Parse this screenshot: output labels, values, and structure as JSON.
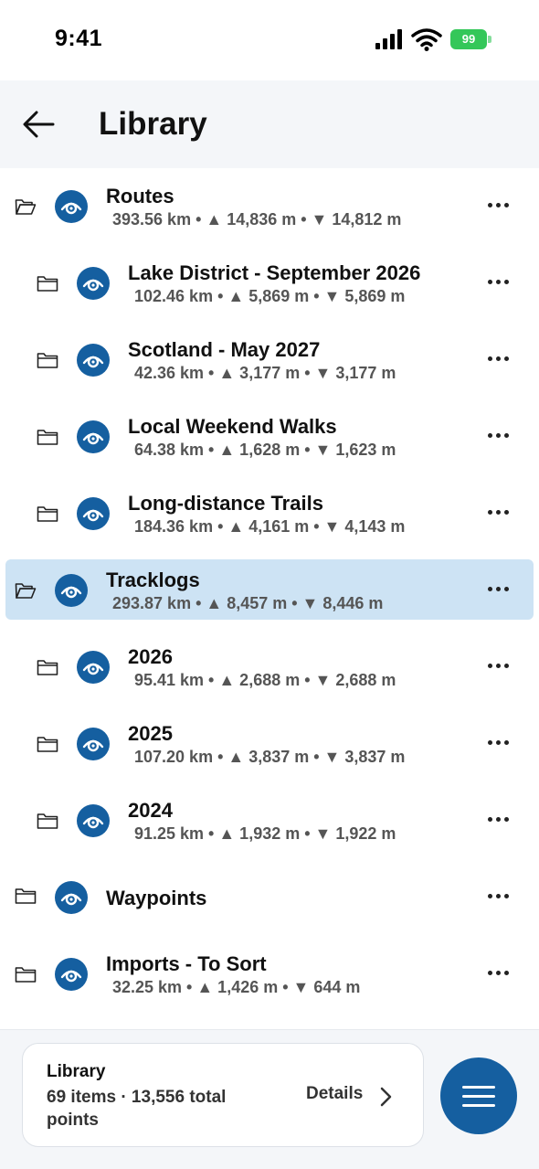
{
  "status_bar": {
    "time": "9:41",
    "battery": "99",
    "battery_color": "#34c759"
  },
  "header": {
    "title": "Library",
    "back_icon": "arrow-left-icon"
  },
  "accent_color": "#155fa0",
  "selected_color": "#cde3f4",
  "items": [
    {
      "title": "Routes",
      "stats": "393.56 km • ▲ 14,836 m • ▼ 14,812 m",
      "level": 0,
      "folder_open": true,
      "selected": false
    },
    {
      "title": "Lake District - September 2026",
      "stats": "102.46 km • ▲ 5,869 m • ▼ 5,869 m",
      "level": 1,
      "folder_open": false,
      "selected": false
    },
    {
      "title": "Scotland - May 2027",
      "stats": "42.36 km • ▲ 3,177 m • ▼ 3,177 m",
      "level": 1,
      "folder_open": false,
      "selected": false
    },
    {
      "title": "Local Weekend Walks",
      "stats": "64.38 km • ▲ 1,628 m • ▼ 1,623 m",
      "level": 1,
      "folder_open": false,
      "selected": false
    },
    {
      "title": "Long-distance Trails",
      "stats": "184.36 km • ▲ 4,161 m • ▼ 4,143 m",
      "level": 1,
      "folder_open": false,
      "selected": false
    },
    {
      "title": "Tracklogs",
      "stats": "293.87 km • ▲ 8,457 m • ▼ 8,446 m",
      "level": 0,
      "folder_open": true,
      "selected": true
    },
    {
      "title": "2026",
      "stats": "95.41 km • ▲ 2,688 m • ▼ 2,688 m",
      "level": 1,
      "folder_open": false,
      "selected": false
    },
    {
      "title": "2025",
      "stats": "107.20 km • ▲ 3,837 m • ▼ 3,837 m",
      "level": 1,
      "folder_open": false,
      "selected": false
    },
    {
      "title": "2024",
      "stats": "91.25 km • ▲ 1,932 m • ▼ 1,922 m",
      "level": 1,
      "folder_open": false,
      "selected": false
    },
    {
      "title": "Waypoints",
      "stats": "",
      "level": 0,
      "folder_open": false,
      "selected": false
    },
    {
      "title": "Imports - To Sort",
      "stats": "32.25 km • ▲ 1,426 m • ▼ 644 m",
      "level": 0,
      "folder_open": false,
      "selected": false
    }
  ],
  "footer": {
    "summary_title": "Library",
    "summary_text": "69 items · 13,556 total points",
    "details_label": "Details",
    "menu_icon": "hamburger-menu-icon"
  }
}
